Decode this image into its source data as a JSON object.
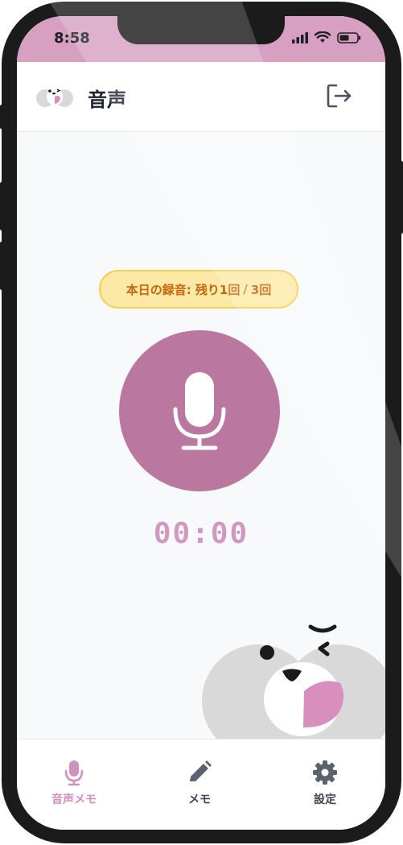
{
  "status_bar": {
    "time": "8:58"
  },
  "header": {
    "title": "音声"
  },
  "recording": {
    "badge_label": "本日の録音: 残り1回",
    "badge_separator": "/",
    "badge_total": "3回",
    "timer": "00:00"
  },
  "tabs": [
    {
      "label": "音声メモ",
      "icon": "microphone-icon",
      "active": true
    },
    {
      "label": "メモ",
      "icon": "pencil-icon",
      "active": false
    },
    {
      "label": "設定",
      "icon": "gear-icon",
      "active": false
    }
  ],
  "colors": {
    "accent": "#ba779f",
    "accent_light": "#d7a0c3",
    "badge_bg": "#fde9a6",
    "badge_border": "#f7cd52",
    "badge_text": "#c5670a",
    "inactive_tab": "#5a6270"
  }
}
